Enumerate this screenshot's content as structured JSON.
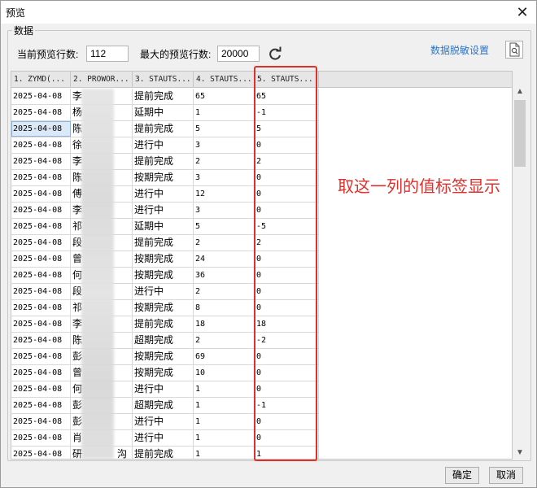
{
  "window": {
    "title": "预览"
  },
  "group": {
    "label": "数据"
  },
  "toolbar": {
    "current_rows_label": "当前预览行数:",
    "current_rows_value": "112",
    "max_rows_label": "最大的预览行数:",
    "max_rows_value": "20000",
    "masking_link": "数据脱敏设置",
    "refresh_icon": "refresh-icon",
    "preview_icon": "document-search-icon"
  },
  "grid": {
    "headers": [
      "1. ZYMD(...",
      "2. PROWOR...",
      "3. STAUTS...",
      "4. STAUTS...",
      "5. STAUTS..."
    ],
    "rows": [
      [
        "2025-04-08",
        "李",
        "提前完成",
        "65",
        "65"
      ],
      [
        "2025-04-08",
        "杨",
        "延期中",
        "1",
        "-1"
      ],
      [
        "2025-04-08",
        "陈",
        "提前完成",
        "5",
        "5"
      ],
      [
        "2025-04-08",
        "徐",
        "进行中",
        "3",
        "0"
      ],
      [
        "2025-04-08",
        "李",
        "提前完成",
        "2",
        "2"
      ],
      [
        "2025-04-08",
        "陈",
        "按期完成",
        "3",
        "0"
      ],
      [
        "2025-04-08",
        "傅",
        "进行中",
        "12",
        "0"
      ],
      [
        "2025-04-08",
        "李",
        "进行中",
        "3",
        "0"
      ],
      [
        "2025-04-08",
        "祁",
        "延期中",
        "5",
        "-5"
      ],
      [
        "2025-04-08",
        "段",
        "提前完成",
        "2",
        "2"
      ],
      [
        "2025-04-08",
        "曾",
        "按期完成",
        "24",
        "0"
      ],
      [
        "2025-04-08",
        "何",
        "按期完成",
        "36",
        "0"
      ],
      [
        "2025-04-08",
        "段",
        "进行中",
        "2",
        "0"
      ],
      [
        "2025-04-08",
        "祁",
        "按期完成",
        "8",
        "0"
      ],
      [
        "2025-04-08",
        "李",
        "提前完成",
        "18",
        "18"
      ],
      [
        "2025-04-08",
        "陈",
        "超期完成",
        "2",
        "-2"
      ],
      [
        "2025-04-08",
        "彭",
        "按期完成",
        "69",
        "0"
      ],
      [
        "2025-04-08",
        "曾",
        "按期完成",
        "10",
        "0"
      ],
      [
        "2025-04-08",
        "何",
        "进行中",
        "1",
        "0"
      ],
      [
        "2025-04-08",
        "彭",
        "超期完成",
        "1",
        "-1"
      ],
      [
        "2025-04-08",
        "彭",
        "进行中",
        "1",
        "0"
      ],
      [
        "2025-04-08",
        "肖",
        "进行中",
        "1",
        "0"
      ],
      [
        "2025-04-08",
        "研",
        "提前完成",
        "1",
        "1"
      ]
    ],
    "last_row_tail": "沟"
  },
  "annotation": {
    "text": "取这一列的值标签显示",
    "color": "#e0302c"
  },
  "buttons": {
    "ok": "确定",
    "cancel": "取消"
  },
  "colors": {
    "link": "#2f74c6",
    "highlight": "#e0302c"
  }
}
